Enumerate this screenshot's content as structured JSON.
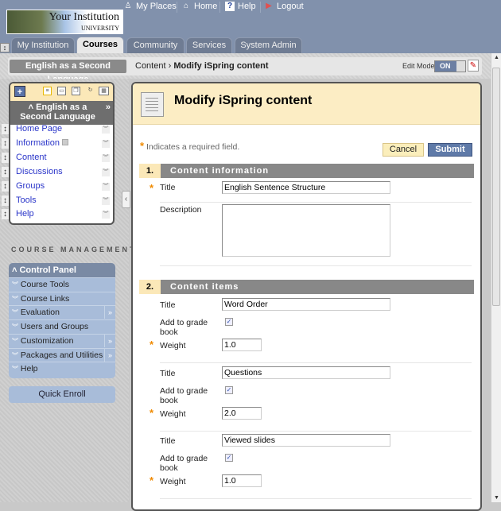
{
  "header": {
    "logo_title": "Your Institution",
    "logo_sub": "UNIVERSITY",
    "links": [
      {
        "label": "My Places",
        "icon": "person-icon"
      },
      {
        "label": "Home",
        "icon": "house-icon"
      },
      {
        "label": "Help",
        "icon": "question-icon"
      },
      {
        "label": "Logout",
        "icon": "door-icon"
      }
    ],
    "tabs": [
      "My Institution",
      "Courses",
      "Community",
      "Services",
      "System Admin"
    ],
    "active_tab": "Courses"
  },
  "breadcrumb": {
    "course": "English as a Second Language",
    "path": "Content",
    "separator": "›",
    "current": "Modify iSpring content",
    "edit_mode_label": "Edit Mode:",
    "edit_mode_value": "ON"
  },
  "course_menu": {
    "title": "English as a Second Language",
    "items": [
      "Home Page",
      "Information",
      "Content",
      "Discussions",
      "Groups",
      "Tools",
      "Help"
    ]
  },
  "course_management": {
    "label": "COURSE MANAGEMENT",
    "control_panel": "Control Panel",
    "items": [
      {
        "label": "Course Tools",
        "more": false
      },
      {
        "label": "Course Links",
        "more": false
      },
      {
        "label": "Evaluation",
        "more": true
      },
      {
        "label": "Users and Groups",
        "more": false
      },
      {
        "label": "Customization",
        "more": true
      },
      {
        "label": "Packages and Utilities",
        "more": true
      },
      {
        "label": "Help",
        "more": false
      }
    ],
    "quick_enroll": "Quick Enroll"
  },
  "page": {
    "title": "Modify iSpring content",
    "required_note": "Indicates a required field.",
    "cancel": "Cancel",
    "submit": "Submit",
    "section1": {
      "num": "1.",
      "title": "Content information",
      "title_label": "Title",
      "title_value": "English Sentence Structure",
      "description_label": "Description",
      "description_value": ""
    },
    "section2": {
      "num": "2.",
      "title": "Content items",
      "items": [
        {
          "title_label": "Title",
          "title": "Word Order",
          "grade_label_1": "Add to grade",
          "grade_label_2": "book",
          "grade_checked": true,
          "weight_label": "Weight",
          "weight": "1.0"
        },
        {
          "title_label": "Title",
          "title": "Questions",
          "grade_label_1": "Add to grade",
          "grade_label_2": "book",
          "grade_checked": true,
          "weight_label": "Weight",
          "weight": "2.0"
        },
        {
          "title_label": "Title",
          "title": "Viewed slides",
          "grade_label_1": "Add to grade",
          "grade_label_2": "book",
          "grade_checked": true,
          "weight_label": "Weight",
          "weight": "1.0"
        }
      ]
    }
  },
  "colors": {
    "header_bg": "#8191ac",
    "accent_yellow": "#fbe8b8",
    "submit_blue": "#5f7aa8",
    "link_blue": "#2a35c9",
    "required_orange": "#f08a00"
  }
}
